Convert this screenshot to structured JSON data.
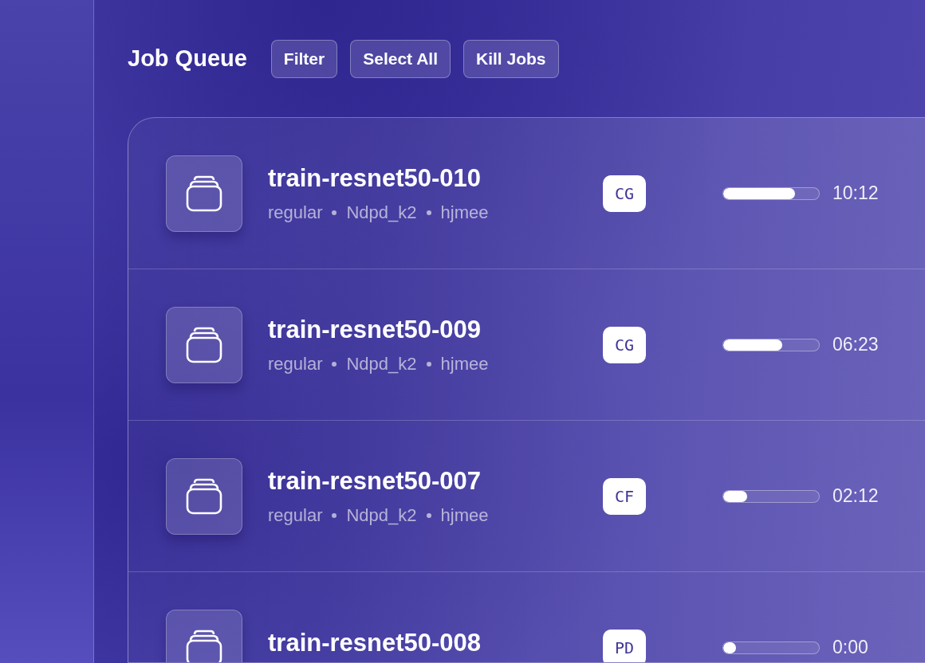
{
  "title": "Job Queue",
  "buttons": [
    "Filter",
    "Select All",
    "Kill Jobs"
  ],
  "jobs": [
    {
      "name": "train-resnet50-010",
      "meta": [
        "regular",
        "Ndpd_k2",
        "hjmee"
      ],
      "status": "CG",
      "level": 0.75,
      "time": "10:12"
    },
    {
      "name": "train-resnet50-009",
      "meta": [
        "regular",
        "Ndpd_k2",
        "hjmee"
      ],
      "status": "CG",
      "level": 0.62,
      "time": "06:23"
    },
    {
      "name": "train-resnet50-007",
      "meta": [
        "regular",
        "Ndpd_k2",
        "hjmee"
      ],
      "status": "CF",
      "level": 0.25,
      "time": "02:12"
    },
    {
      "name": "train-resnet50-008",
      "status": "PD",
      "level": 0.13,
      "time": "0:00"
    }
  ]
}
